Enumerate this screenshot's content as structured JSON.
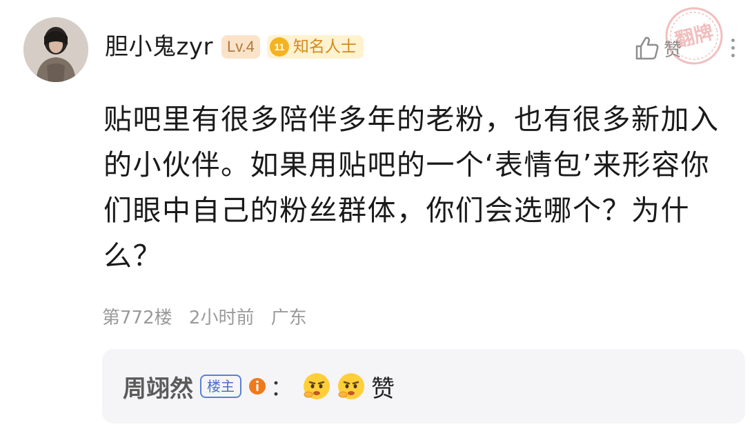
{
  "post": {
    "author": {
      "name": "胆小鬼zyr",
      "level": "Lv.4",
      "fame_count": "11",
      "fame_title": "知名人士"
    },
    "like_label": "赞",
    "stamp_text": "翻牌",
    "content": "贴吧里有很多陪伴多年的老粉，也有很多新加入的小伙伴。如果用贴吧的一个‘表情包’来形容你们眼中自己的粉丝群体，你们会选哪个？为什么？",
    "meta": {
      "floor": "第772楼",
      "time": "2小时前",
      "location": "广东"
    }
  },
  "reply": {
    "user": "周翊然",
    "badge": "楼主",
    "colon": "：",
    "emoji_icons": [
      "thinking-face-icon",
      "thinking-face-icon"
    ],
    "text": "赞"
  },
  "colors": {
    "level_badge_bg": "#fbe3c9",
    "fame_badge_bg": "#fff2cf",
    "owner_badge": "#4a6fc4",
    "reply_bg": "#f5f5f8",
    "meta_text": "#9a9a9a"
  }
}
